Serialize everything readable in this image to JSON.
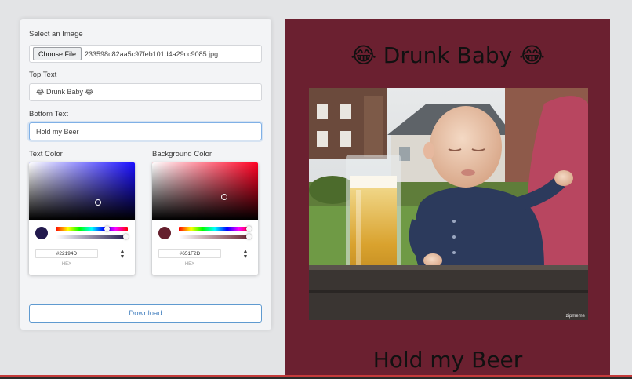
{
  "form": {
    "select_image_label": "Select an Image",
    "choose_file_label": "Choose File",
    "file_name": "233598c82aa5c97feb101d4a29cc9085.jpg",
    "top_text_label": "Top Text",
    "top_text_value": "😂 Drunk Baby 😂",
    "bottom_text_label": "Bottom Text",
    "bottom_text_value": "Hold my Beer",
    "text_color_label": "Text Color",
    "background_color_label": "Background Color",
    "download_label": "Download"
  },
  "text_color_picker": {
    "hex_value": "#22194D",
    "hex_label": "HEX",
    "hue_color": "#1a0fff",
    "swatch_color": "#22194D"
  },
  "bg_color_picker": {
    "hex_value": "#651F2D",
    "hex_label": "HEX",
    "hue_color": "#ff0022",
    "swatch_color": "#651F2D"
  },
  "meme": {
    "top_text": "😂 Drunk Baby 😂",
    "bottom_text": "Hold my Beer",
    "background_color": "#6b2030",
    "watermark": "zipmeme"
  }
}
